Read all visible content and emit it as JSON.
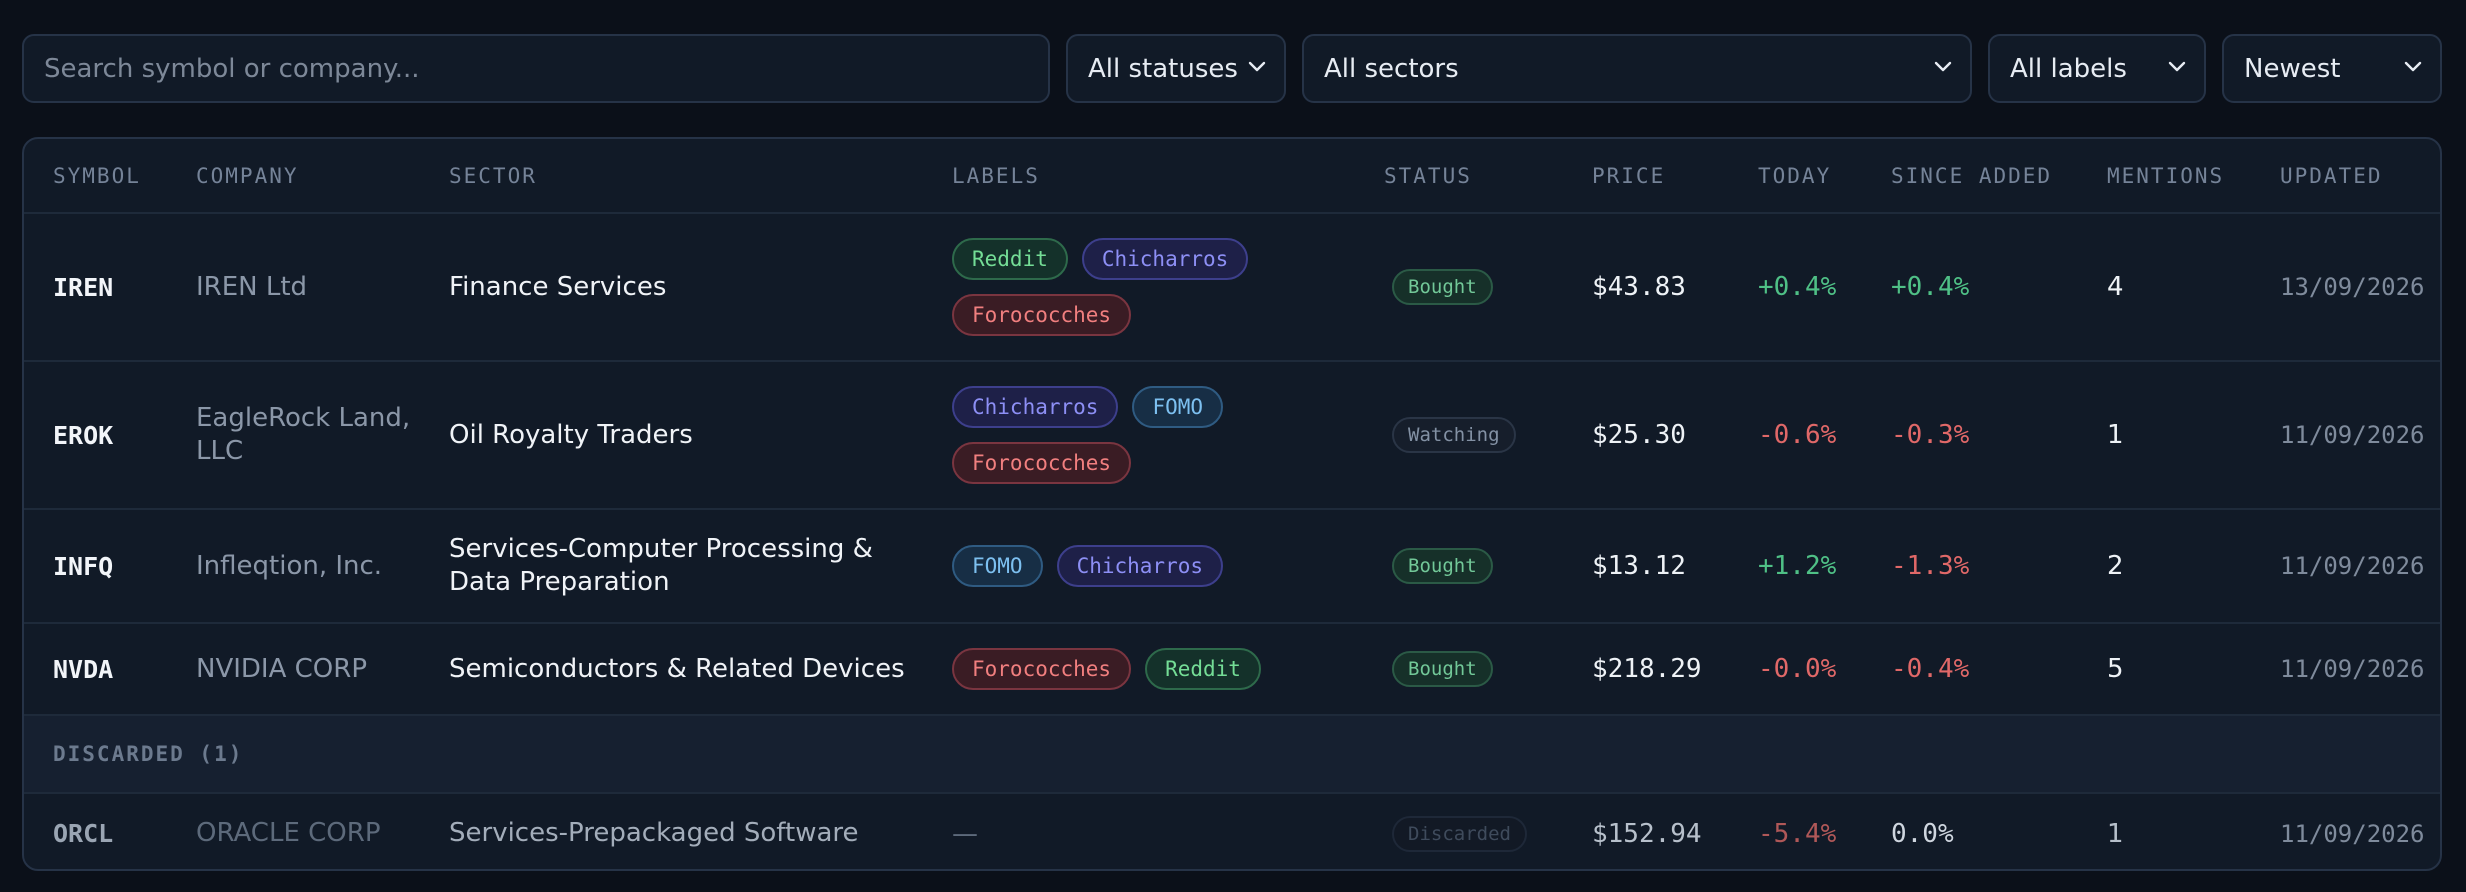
{
  "filters": {
    "search_placeholder": "Search symbol or company...",
    "status_value": "All statuses",
    "sector_value": "All sectors",
    "labels_value": "All labels",
    "sort_value": "Newest"
  },
  "table": {
    "headers": [
      "SYMBOL",
      "COMPANY",
      "SECTOR",
      "LABELS",
      "STATUS",
      "PRICE",
      "TODAY",
      "SINCE ADDED",
      "MENTIONS",
      "UPDATED"
    ],
    "rows": [
      {
        "symbol": "IREN",
        "company": "IREN Ltd",
        "sector": "Finance Services",
        "labels": [
          "Reddit",
          "Chicharros",
          "Forococches"
        ],
        "status": "Bought",
        "price": "$43.83",
        "today": "+0.4%",
        "since_added": "+0.4%",
        "mentions": "4",
        "updated": "13/09/2026"
      },
      {
        "symbol": "EROK",
        "company": "EagleRock Land, LLC",
        "sector": "Oil Royalty Traders",
        "labels": [
          "Chicharros",
          "FOMO",
          "Forococches"
        ],
        "status": "Watching",
        "price": "$25.30",
        "today": "-0.6%",
        "since_added": "-0.3%",
        "mentions": "1",
        "updated": "11/09/2026"
      },
      {
        "symbol": "INFQ",
        "company": "Infleqtion, Inc.",
        "sector": "Services-Computer Processing & Data Preparation",
        "labels": [
          "FOMO",
          "Chicharros"
        ],
        "status": "Bought",
        "price": "$13.12",
        "today": "+1.2%",
        "since_added": "-1.3%",
        "mentions": "2",
        "updated": "11/09/2026"
      },
      {
        "symbol": "NVDA",
        "company": "NVIDIA CORP",
        "sector": "Semiconductors & Related Devices",
        "labels": [
          "Forococches",
          "Reddit"
        ],
        "status": "Bought",
        "price": "$218.29",
        "today": "-0.0%",
        "since_added": "-0.4%",
        "mentions": "5",
        "updated": "11/09/2026"
      }
    ],
    "discarded_section": "DISCARDED (1)",
    "discarded_rows": [
      {
        "symbol": "ORCL",
        "company": "ORACLE CORP",
        "sector": "Services-Prepackaged Software",
        "labels_empty": "—",
        "status": "Discarded",
        "price": "$152.94",
        "today": "-5.4%",
        "since_added": "0.0%",
        "mentions": "1",
        "updated": "11/09/2026"
      }
    ]
  },
  "colors": {
    "background": "#0b1019",
    "panel": "#111a27",
    "positive": "#4fc086",
    "negative": "#e06868",
    "tag_reddit": "#74dd96",
    "tag_chicharros": "#8d8ff5",
    "tag_forocoches": "#f17f7f",
    "tag_fomo": "#7dc0f0"
  },
  "icons": {
    "dropdown": "chevron-down-icon"
  }
}
